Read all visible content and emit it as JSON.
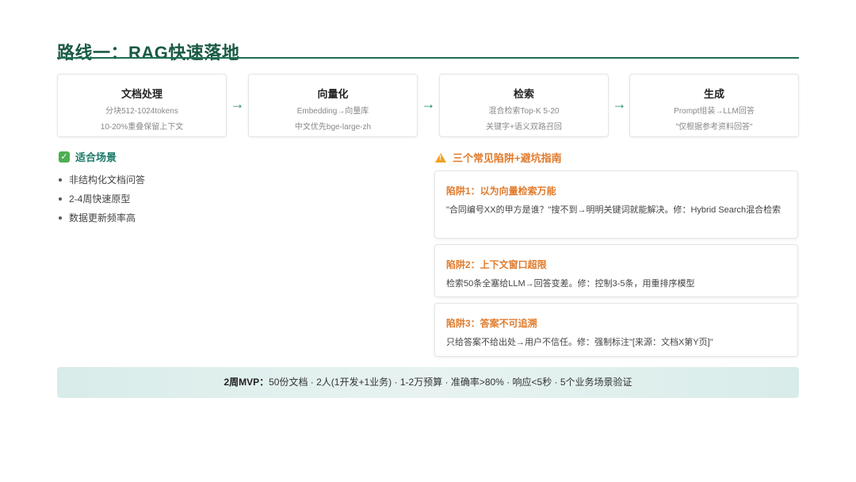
{
  "title": "路线一：RAG快速落地",
  "flow": {
    "steps": [
      {
        "title": "文档处理",
        "lines": [
          "分块512-1024tokens",
          "10-20%重叠保留上下文"
        ]
      },
      {
        "title": "向量化",
        "lines": [
          "Embedding→向量库",
          "中文优先bge-large-zh"
        ]
      },
      {
        "title": "检索",
        "lines": [
          "混合检索Top-K 5-20",
          "关键字+语义双路召回"
        ]
      },
      {
        "title": "生成",
        "lines": [
          "Prompt组装→LLM回答",
          "\"仅根据参考资料回答\""
        ]
      }
    ],
    "arrow": "→"
  },
  "fit": {
    "heading": "适合场景",
    "icon": "check-icon",
    "items": [
      "非结构化文档问答",
      "2-4周快速原型",
      "数据更新频率高"
    ]
  },
  "pitfalls": {
    "heading": "三个常见陷阱+避坑指南",
    "icon": "warning-icon",
    "items": [
      {
        "title": "陷阱1：以为向量检索万能",
        "body": "\"合同编号XX的甲方是谁？\"搜不到→明明关键词就能解决。修：Hybrid Search混合检索"
      },
      {
        "title": "陷阱2：上下文窗口超限",
        "body": "检索50条全塞给LLM→回答变差。修：控制3-5条，用重排序模型"
      },
      {
        "title": "陷阱3：答案不可追溯",
        "body": "只给答案不给出处→用户不信任。修：强制标注\"[来源：文档X第Y页]\""
      }
    ]
  },
  "mvp": {
    "label": "2周MVP：",
    "text": "50份文档 · 2人(1开发+1业务) · 1-2万预算 · 准确率>80% · 响应<5秒 · 5个业务场景验证"
  },
  "colors": {
    "accent": "#1f6e58",
    "warning": "#e07b2c",
    "mvp_bg": "#dcefec"
  }
}
